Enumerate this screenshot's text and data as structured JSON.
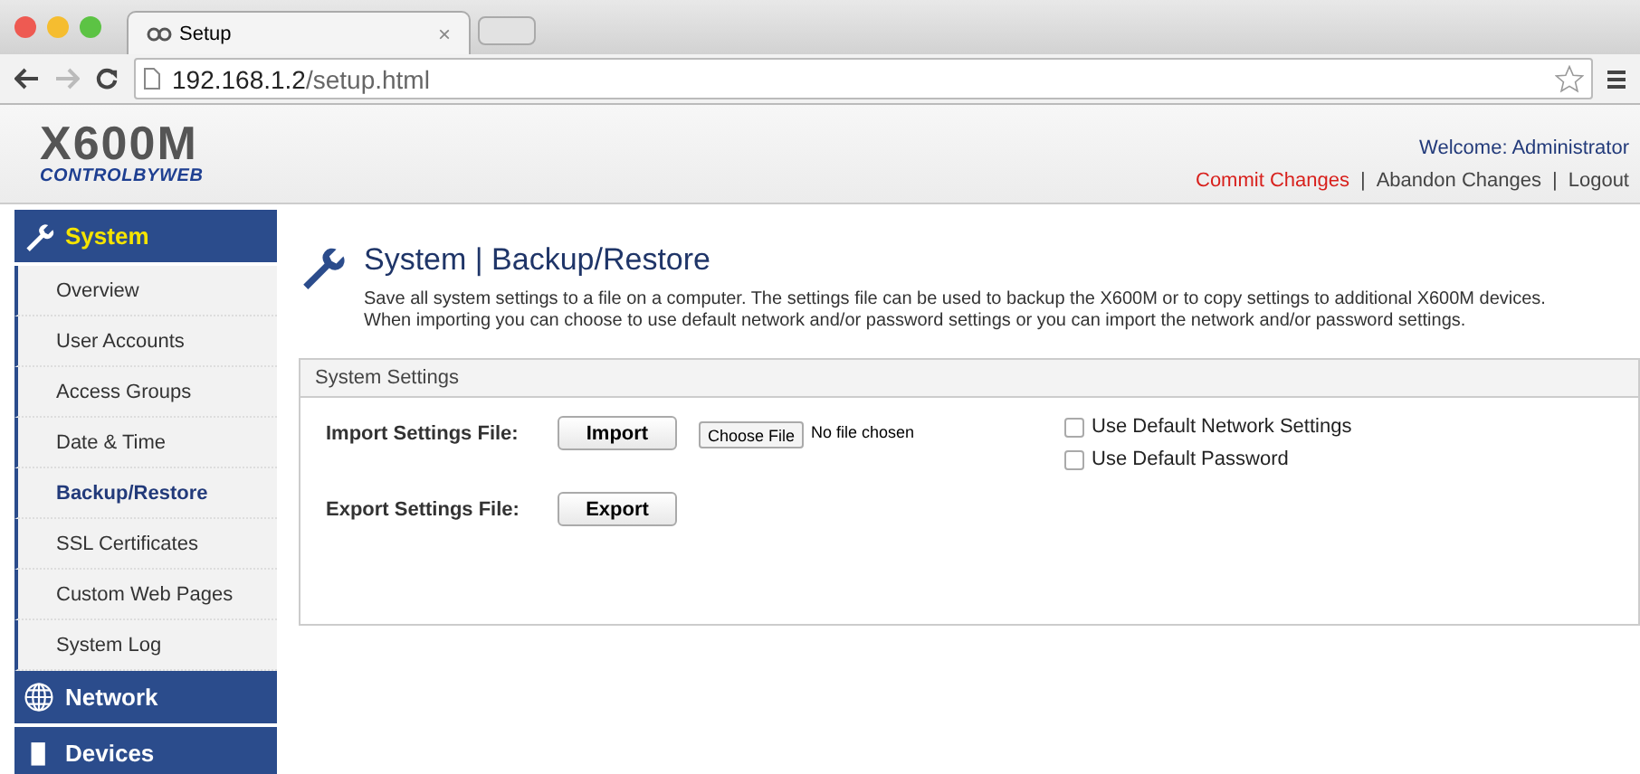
{
  "browser": {
    "tabs": [
      {
        "title": "Setup",
        "close": "×",
        "selected": true
      }
    ],
    "url_host": "192.168.1.2",
    "url_path": "/setup.html"
  },
  "header": {
    "logo": "X600M",
    "brand": "CONTROLBYWEB",
    "welcome": "Welcome: Administrator",
    "links": [
      {
        "kind": "commit",
        "label": "Commit Changes"
      },
      {
        "kind": "separator",
        "label": "|"
      },
      {
        "kind": "link",
        "label": "Abandon Changes"
      },
      {
        "kind": "separator",
        "label": "|"
      },
      {
        "kind": "link",
        "label": "Logout"
      }
    ]
  },
  "sidebar": {
    "sections": [
      {
        "label": "System",
        "expanded": true,
        "children": [
          {
            "label": "Overview",
            "selected": false
          },
          {
            "label": "User Accounts",
            "selected": false
          },
          {
            "label": "Access Groups",
            "selected": false
          },
          {
            "label": "Date & Time",
            "selected": false
          },
          {
            "label": "Backup/Restore",
            "selected": true
          },
          {
            "label": "SSL Certificates",
            "selected": false
          },
          {
            "label": "Custom Web Pages",
            "selected": false
          },
          {
            "label": "System Log",
            "selected": false
          }
        ]
      },
      {
        "label": "Network",
        "expanded": false
      },
      {
        "label": "Devices",
        "expanded": false
      }
    ]
  },
  "page": {
    "title": "System | Backup/Restore",
    "description": "Save all system settings to a file on a computer. The settings file can be used to backup the X600M or to copy settings to additional X600M devices. When importing you can choose to use default network and/or password settings or you can import the network and/or password settings.",
    "panel": {
      "title": "System Settings",
      "import": {
        "label": "Import Settings File:",
        "button": "Import",
        "file_button": "Choose File",
        "file_status": "No file chosen",
        "options": [
          {
            "label": "Use Default Network Settings",
            "checked": false
          },
          {
            "label": "Use Default Password",
            "checked": false
          }
        ]
      },
      "export": {
        "label": "Export Settings File:",
        "button": "Export"
      }
    }
  }
}
